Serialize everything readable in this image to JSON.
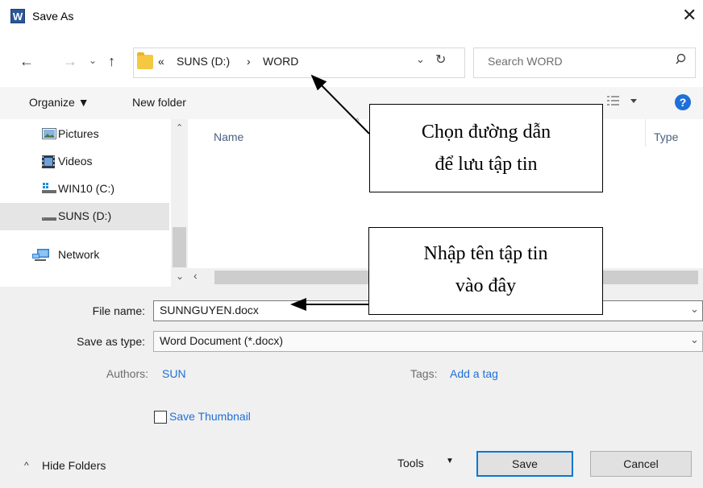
{
  "window": {
    "title": "Save As",
    "app_icon_letter": "W"
  },
  "address": {
    "crumbs": [
      "«",
      "SUNS (D:)",
      "›",
      "WORD"
    ]
  },
  "search": {
    "placeholder": "Search WORD"
  },
  "toolbar": {
    "organize": "Organize ▼",
    "new_folder": "New folder",
    "help": "?"
  },
  "nav_pane": {
    "items": [
      {
        "label": "Pictures",
        "icon": "pictures-icon"
      },
      {
        "label": "Videos",
        "icon": "videos-icon"
      },
      {
        "label": "WIN10 (C:)",
        "icon": "drive-icon"
      },
      {
        "label": "SUNS (D:)",
        "icon": "drive-icon",
        "selected": true
      },
      {
        "label": "Network",
        "icon": "network-icon"
      }
    ]
  },
  "columns": {
    "name": "Name",
    "type": "Type"
  },
  "form": {
    "file_name_label": "File name:",
    "file_name_value": "SUNNGUYEN.docx",
    "save_type_label": "Save as type:",
    "save_type_value": "Word Document (*.docx)",
    "authors_label": "Authors:",
    "authors_value": "SUN",
    "tags_label": "Tags:",
    "tags_value": "Add a tag",
    "thumbnail_label": "Save Thumbnail"
  },
  "footer": {
    "hide_folders": "Hide Folders",
    "tools": "Tools",
    "save": "Save",
    "cancel": "Cancel"
  },
  "annotations": {
    "callout1": [
      "Chọn đường dẫn",
      "để lưu tập tin"
    ],
    "callout2": [
      "Nhập tên tập tin",
      "vào đây"
    ]
  },
  "colors": {
    "accent": "#0078d7",
    "link": "#1e6fd9",
    "word_blue": "#2b579a"
  }
}
